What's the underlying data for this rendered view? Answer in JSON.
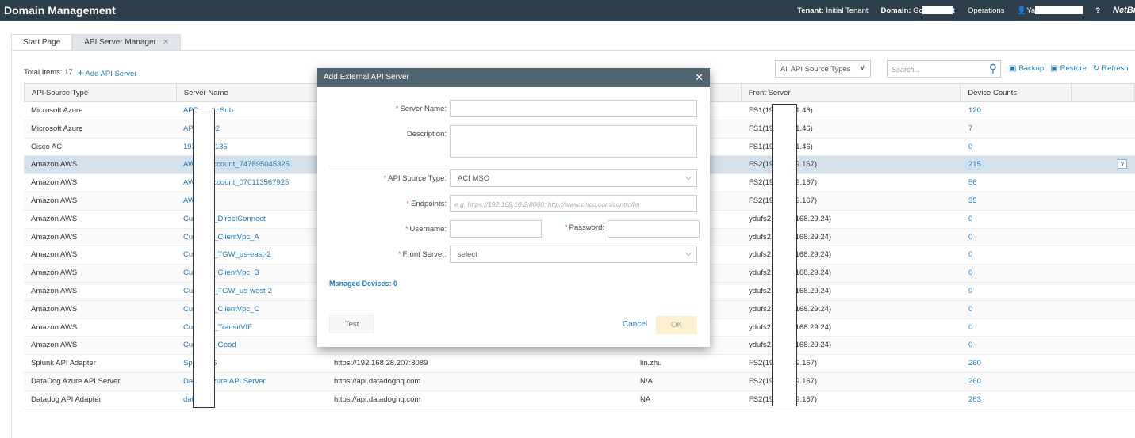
{
  "header": {
    "title": "Domain Management",
    "tenant_label": "Tenant:",
    "tenant_value": "Initial Tenant",
    "domain_label": "Domain:",
    "domain_value_start": "Gc",
    "domain_value_end": "t",
    "operations": "Operations",
    "user_start": "Ya",
    "help": "?",
    "logo": "NetBrain"
  },
  "tabs": [
    {
      "label": "Start Page",
      "active": false
    },
    {
      "label": "API Server Manager",
      "active": true,
      "close": "✕"
    }
  ],
  "toolbar": {
    "total_items": "Total Items: 17",
    "add_label": "Add API Server",
    "filter_value": "All API Source Types",
    "search_placeholder": "Search...",
    "backup": "Backup",
    "restore": "Restore",
    "refresh": "Refresh"
  },
  "table": {
    "headers": [
      "API Source Type",
      "Server Name",
      "",
      "",
      "Front Server",
      "Device Counts",
      ""
    ],
    "rows": [
      {
        "type": "Microsoft Azure",
        "name_a": "APR",
        "name_b": "th Sub",
        "endpoint": "",
        "user": "",
        "fs_a": "FS1(19",
        "fs_b": "1.46)",
        "count": "120"
      },
      {
        "type": "Microsoft Azure",
        "name_a": "APR",
        "name_b": "02",
        "endpoint": "",
        "user": "",
        "fs_a": "FS1(19",
        "fs_b": "1.46)",
        "count": "7"
      },
      {
        "type": "Cisco ACI",
        "name_a": "192",
        "name_b": "3.135",
        "endpoint": "",
        "user": "",
        "fs_a": "FS1(19",
        "fs_b": "1.46)",
        "count": "0"
      },
      {
        "type": "Amazon AWS",
        "name_a": "AW",
        "name_b": "Account_747895045325",
        "endpoint": "",
        "user": "",
        "fs_a": "FS2(19",
        "fs_b": "9.167)",
        "count": "215",
        "selected": true
      },
      {
        "type": "Amazon AWS",
        "name_a": "AW",
        "name_b": "Account_070113567925",
        "endpoint": "",
        "user": "",
        "fs_a": "FS2(19",
        "fs_b": "9.167)",
        "count": "56"
      },
      {
        "type": "Amazon AWS",
        "name_a": "AW",
        "name_b": "",
        "endpoint": "",
        "user": "",
        "fs_a": "FS2(19",
        "fs_b": "9.167)",
        "count": "35"
      },
      {
        "type": "Amazon AWS",
        "name_a": "Cus",
        "name_b": "1_DirectConnect",
        "endpoint": "",
        "user": "",
        "fs_a": "ydufs2",
        "fs_b": ".168.29.24)",
        "count": "0"
      },
      {
        "type": "Amazon AWS",
        "name_a": "Cus",
        "name_b": "1_ClientVpc_A",
        "endpoint": "",
        "user": "",
        "fs_a": "ydufs2",
        "fs_b": ".168.29.24)",
        "count": "0"
      },
      {
        "type": "Amazon AWS",
        "name_a": "Cus",
        "name_b": "1_TGW_us-east-2",
        "endpoint": "",
        "user": "",
        "fs_a": "ydufs2",
        "fs_b": ".168.29.24)",
        "count": "0"
      },
      {
        "type": "Amazon AWS",
        "name_a": "Cus",
        "name_b": "1_ClientVpc_B",
        "endpoint": "",
        "user": "",
        "fs_a": "ydufs2",
        "fs_b": ".168.29.24)",
        "count": "0"
      },
      {
        "type": "Amazon AWS",
        "name_a": "Cus",
        "name_b": "1_TGW_us-west-2",
        "endpoint": "",
        "user": "",
        "fs_a": "ydufs2",
        "fs_b": ".168.29.24)",
        "count": "0"
      },
      {
        "type": "Amazon AWS",
        "name_a": "Cus",
        "name_b": "1_ClientVpc_C",
        "endpoint": "",
        "user": "",
        "fs_a": "ydufs2",
        "fs_b": ".168.29.24)",
        "count": "0"
      },
      {
        "type": "Amazon AWS",
        "name_a": "Cus",
        "name_b": "2_TransitVIF",
        "endpoint": "",
        "user": "",
        "fs_a": "ydufs2",
        "fs_b": ".168.29.24)",
        "count": "0"
      },
      {
        "type": "Amazon AWS",
        "name_a": "Cus",
        "name_b": "3_Good",
        "endpoint": "",
        "user": "",
        "fs_a": "ydufs2",
        "fs_b": ".168.29.24)",
        "count": "0"
      },
      {
        "type": "Splunk API Adapter",
        "name_a": "Spl",
        "name_b": "VS",
        "endpoint": "https://192.168.28.207:8089",
        "user": "lin.zhu",
        "fs_a": "FS2(19",
        "fs_b": "9.167)",
        "count": "260"
      },
      {
        "type": "DataDog Azure API Server",
        "name_a": "Dat",
        "name_b": "Azure API Server",
        "endpoint": "https://api.datadoghq.com",
        "user": "N/A",
        "fs_a": "FS2(19",
        "fs_b": "9.167)",
        "count": "260"
      },
      {
        "type": "Datadog API Adapter",
        "name_a": "dat",
        "name_b": "",
        "endpoint": "https://api.datadoghq.com",
        "user": "NA",
        "fs_a": "FS2(19",
        "fs_b": "9.167)",
        "count": "263"
      }
    ]
  },
  "dialog": {
    "title": "Add External API Server",
    "server_name_label": "Server Name:",
    "server_name_value": "",
    "description_label": "Description:",
    "description_value": "",
    "api_source_type_label": "API Source Type:",
    "api_source_type_value": "ACI MSO",
    "endpoints_label": "Endpoints:",
    "endpoints_placeholder": "e.g. https://192.168.10.2:8080; http://www.cisco.com/controller",
    "username_label": "Username:",
    "password_label": "Password:",
    "front_server_label": "Front Server:",
    "front_server_value": "select",
    "managed_devices": "Managed Devices: 0",
    "test": "Test",
    "cancel": "Cancel",
    "ok": "OK",
    "required_mark": "*"
  },
  "colors": {
    "topbar": "#2e3f4c",
    "dialog_header": "#526470",
    "link": "#1f7ab8",
    "selected_row": "#d3e2ea",
    "ok_button": "#fdf0d0"
  }
}
